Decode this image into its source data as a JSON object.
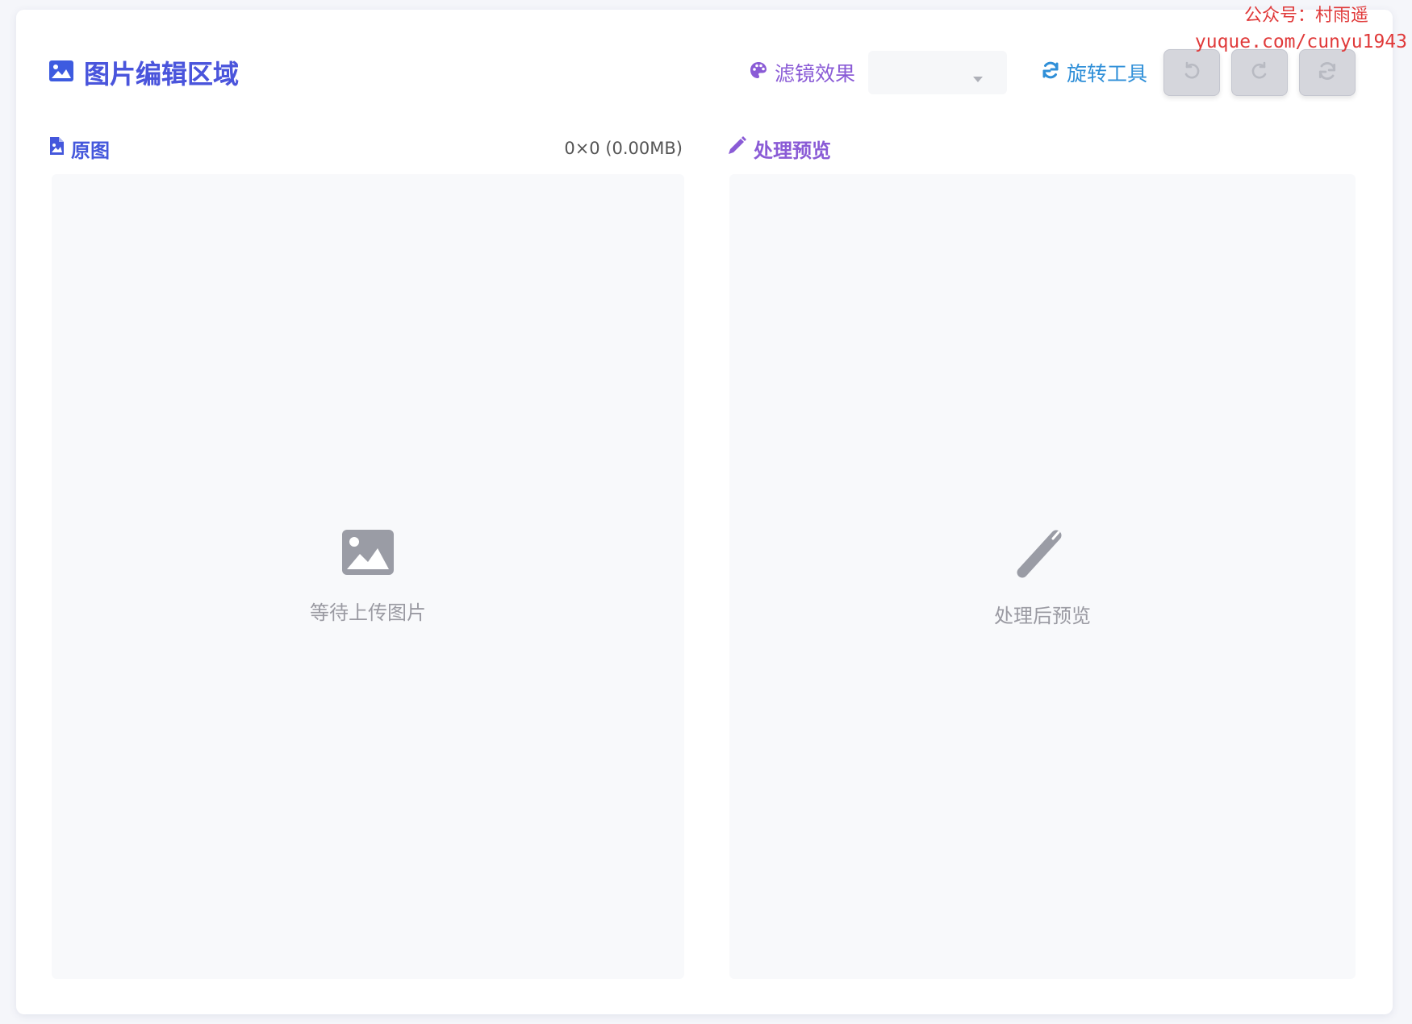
{
  "header": {
    "title": "图片编辑区域",
    "filter_label": "滤镜效果",
    "filter_selected": "",
    "rotate_label": "旋转工具",
    "buttons": [
      {
        "icon": "rotate-left-icon"
      },
      {
        "icon": "rotate-right-icon"
      },
      {
        "icon": "reset-icon"
      }
    ]
  },
  "original": {
    "title": "原图",
    "meta": "0×0 (0.00MB)",
    "placeholder": "等待上传图片",
    "icon": "image-icon"
  },
  "preview": {
    "title": "处理预览",
    "placeholder": "处理后预览",
    "icon": "magic-wand-icon"
  },
  "watermark": {
    "line1": "公众号：村雨遥",
    "line2": "yuque.com/cunyu1943"
  },
  "colors": {
    "title_start": "#3a5ae0",
    "title_end": "#7b4fd8",
    "filter": "#8a5bd6",
    "rotate": "#2f8fd8",
    "watermark": "#e03a3a"
  }
}
